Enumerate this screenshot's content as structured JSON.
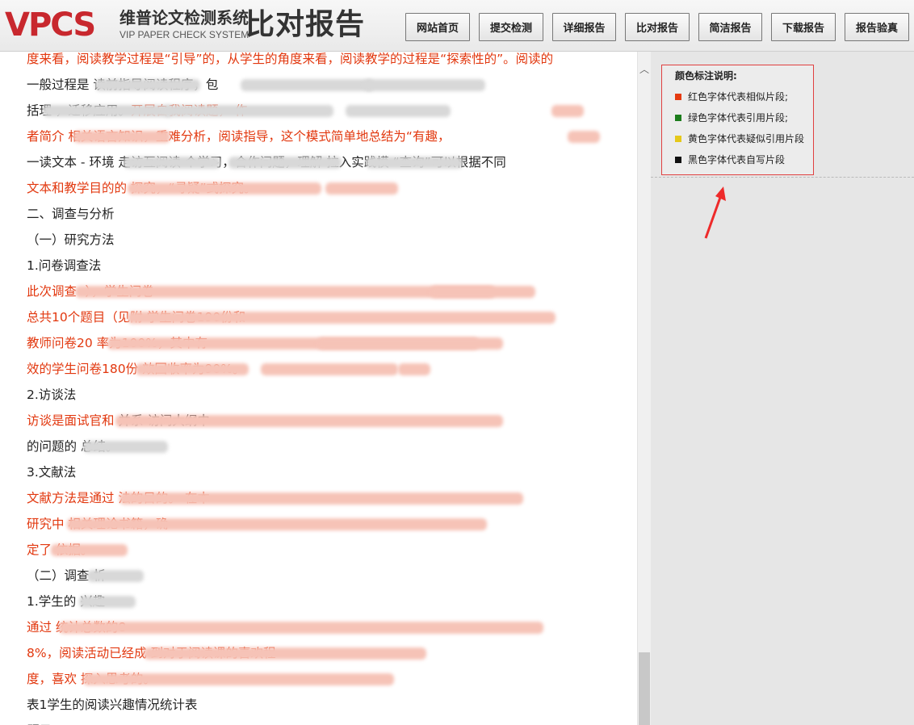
{
  "header": {
    "logo_text": "VPCS",
    "logo_cn": "维普论文检测系统",
    "logo_en": "VIP PAPER CHECK SYSTEM",
    "report_title": "比对报告",
    "nav": [
      "网站首页",
      "提交检测",
      "详细报告",
      "比对报告",
      "简洁报告",
      "下载报告",
      "报告验真"
    ]
  },
  "doc": {
    "lines": [
      {
        "color": "red",
        "text": "度来看，阅读教学过程是“引导”的，从学生的角度来看，阅读教学的过程是“探索性的”。阅读的"
      },
      {
        "color": "black",
        "text": "一般过程是                                                                     读前指导阅读程序，包"
      },
      {
        "color": "black",
        "text": "括理                                                          ，迁移应用。",
        "tail_red": "开展自我阅读题，  作"
      },
      {
        "color": "red",
        "text": "者简介                      相关语言知识，重难分析，阅读指导，这个模式简单地总结为“有趣，"
      },
      {
        "color": "black",
        "text": "一读文本 - 环境  走访互阅读    个学习，合作问题，理解  拉入实践模            “查询”可以根据不同"
      },
      {
        "color": "red",
        "text": "文本和教学目的的                                                   探究，“寻疑”式探究。"
      },
      {
        "color": "black",
        "text": "二、调查与分析"
      },
      {
        "color": "black",
        "text": "（一）研究方法"
      },
      {
        "color": "black",
        "text": "1.问卷调查法"
      },
      {
        "color": "red",
        "text": "此次调查                                                                          -），学生问卷"
      },
      {
        "color": "red",
        "text": "总共10个题目（见附                                                       学生问卷190份和"
      },
      {
        "color": "red",
        "text": "教师问卷20                                                                         率为100%，其中有"
      },
      {
        "color": "red",
        "text": "效的学生问卷180份                                                   效回收率为90%。"
      },
      {
        "color": "black",
        "text": "2.访谈法"
      },
      {
        "color": "red",
        "text": "访谈是面试官和                                                          ",
        "tail_black": "并系        访问大纲中"
      },
      {
        "color": "black",
        "text": "的问题的                       总结。"
      },
      {
        "color": "black",
        "text": "3.文献法"
      },
      {
        "color": "red",
        "text": "文献方法是通过                                                                      法的目的。 在本"
      },
      {
        "color": "red",
        "text": "研究中                                                                                     相关理论书籍，确"
      },
      {
        "color": "red",
        "text": "定了                      依据。"
      },
      {
        "color": "black",
        "text": "（二）调查                析"
      },
      {
        "color": "black",
        "text": "1.学生的             兴趣"
      },
      {
        "color": "red",
        "text": "通过                                                                              统计总数的8"
      },
      {
        "color": "red",
        "text": "8%，阅读活动已经成                                                                   到对于阅读课的喜欢程"
      },
      {
        "color": "red",
        "text": "度，喜欢                                                                       探入思考的。"
      },
      {
        "color": "black",
        "text": "表1学生的阅读兴趣情况统计表"
      },
      {
        "color": "black",
        "text": "题目"
      }
    ]
  },
  "legend": {
    "title": "颜色标注说明:",
    "items": [
      {
        "label": "红色字体代表相似片段;",
        "color": "#e53a10"
      },
      {
        "label": "绿色字体代表引用片段;",
        "color": "#1c7d1c"
      },
      {
        "label": "黄色字体代表疑似引用片段",
        "color": "#e5c81a"
      },
      {
        "label": "黑色字体代表自写片段",
        "color": "#111111"
      }
    ]
  }
}
